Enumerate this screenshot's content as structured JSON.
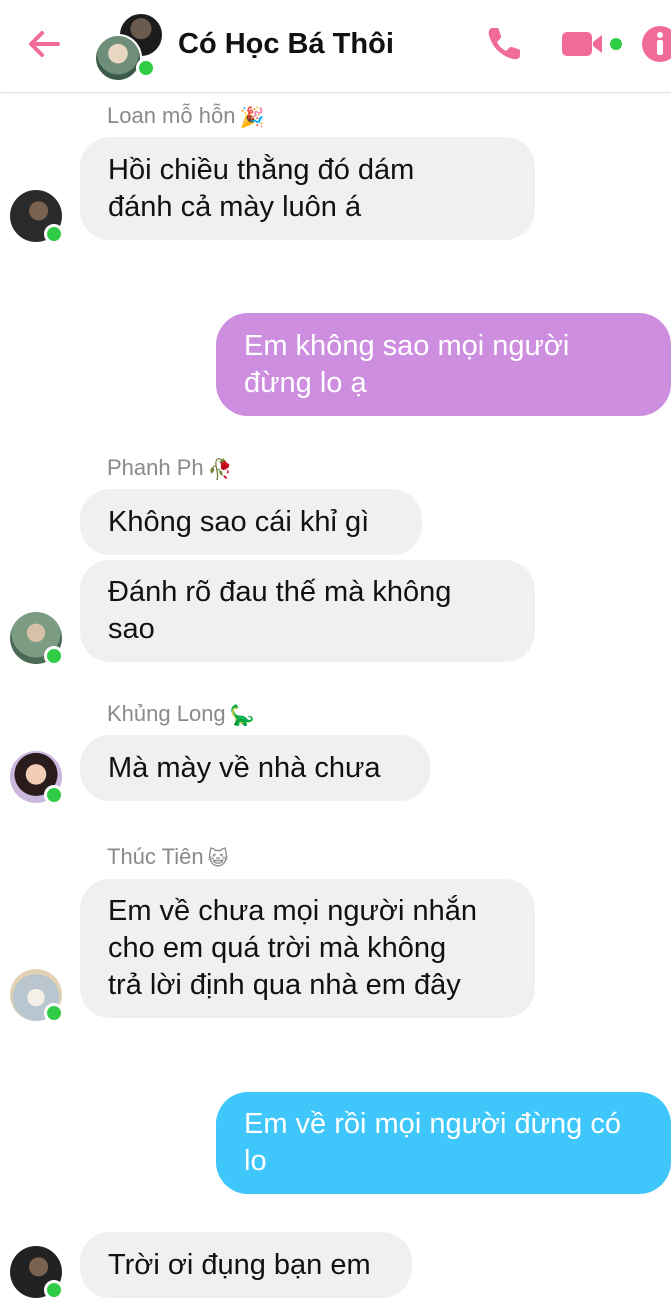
{
  "header": {
    "title": "Có Học Bá Thôi",
    "accent_color": "#f06b9a",
    "icons": [
      "back-arrow-icon",
      "phone-icon",
      "video-camera-icon",
      "info-icon"
    ]
  },
  "messages": [
    {
      "sender": "Loan mỗ hỗn",
      "sender_emoji": "🎉",
      "text_lines": [
        "Hồi chiều thằng đó dám",
        "đánh cả mày luôn á"
      ]
    },
    {
      "outgoing": true,
      "color": "#cd8ee0",
      "text_lines": [
        "Em không sao mọi người",
        "đừng lo ạ"
      ]
    },
    {
      "sender": "Phanh Ph",
      "sender_emoji": "🥀",
      "text_lines": [
        "Không sao cái khỉ gì"
      ]
    },
    {
      "text_lines": [
        "Đánh rõ đau thế mà không",
        "sao"
      ]
    },
    {
      "sender": "Khủng Long",
      "sender_emoji": "🦕",
      "text_lines": [
        "Mà mày về nhà chưa"
      ]
    },
    {
      "sender": "Thúc Tiên",
      "sender_emoji": "😺",
      "text_lines": [
        "Em về chưa mọi người nhắn",
        "cho em quá trời mà không",
        "trả lời định qua nhà em đây"
      ]
    },
    {
      "outgoing": true,
      "color": "#3fc7fb",
      "text_lines": [
        "Em về rồi mọi người đừng có",
        "lo"
      ]
    },
    {
      "text_lines": [
        "Trời ơi đụng bạn em"
      ]
    }
  ]
}
